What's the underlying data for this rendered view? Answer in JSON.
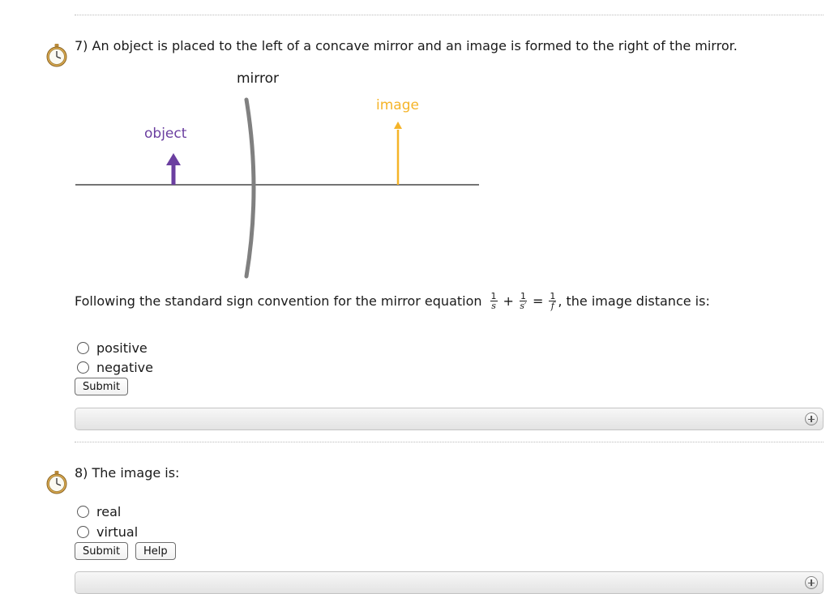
{
  "question7": {
    "text": "7) An object is placed to the left of a concave mirror and an image is formed to the right of the mirror.",
    "diagram": {
      "mirror_label": "mirror",
      "object_label": "object",
      "image_label": "image",
      "object_color": "#6b3fa0",
      "image_color": "#f5b428",
      "mirror_color": "#808080"
    },
    "prompt_before": "Following the standard sign convention for the mirror equation",
    "equation": {
      "term1_num": "1",
      "term1_den": "s",
      "plus": "+",
      "term2_num": "1",
      "term2_den": "s′",
      "equals": "=",
      "term3_num": "1",
      "term3_den": "f"
    },
    "prompt_after": ", the image distance is:",
    "options": [
      "positive",
      "negative"
    ],
    "submit_label": "Submit"
  },
  "question8": {
    "text": "8) The image is:",
    "options": [
      "real",
      "virtual"
    ],
    "submit_label": "Submit",
    "help_label": "Help"
  },
  "icons": {
    "clock": "stopwatch-icon",
    "expand": "plus-circle-icon"
  }
}
